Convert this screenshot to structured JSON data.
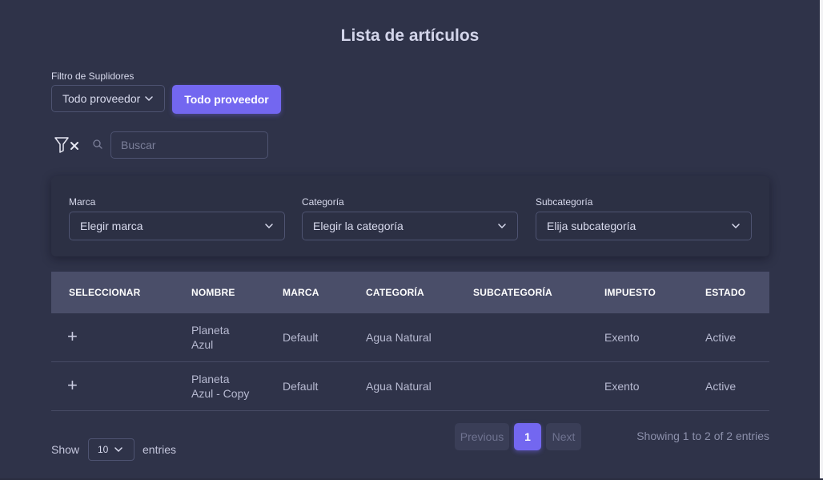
{
  "page": {
    "title": "Lista de artículos"
  },
  "supplier_filter": {
    "label": "Filtro de Suplidores",
    "select_value": "Todo proveedor",
    "button_label": "Todo proveedor"
  },
  "search": {
    "placeholder": "Buscar",
    "clear_icon": "filter-clear-icon",
    "icon": "search-icon"
  },
  "filters": {
    "brand": {
      "label": "Marca",
      "value": "Elegir marca"
    },
    "category": {
      "label": "Categoría",
      "value": "Elegir la categoría"
    },
    "subcategory": {
      "label": "Subcategoría",
      "value": "Elija subcategoría"
    }
  },
  "table": {
    "headers": {
      "select": "SELECCIONAR",
      "name": "NOMBRE",
      "brand": "MARCA",
      "category": "CATEGORÍA",
      "subcategory": "SUBCATEGORÍA",
      "tax": "IMPUESTO",
      "status": "ESTADO"
    },
    "rows": [
      {
        "select": "+",
        "name_line1": "Planeta",
        "name_line2": "Azul",
        "brand": "Default",
        "category": "Agua Natural",
        "subcategory": "",
        "tax": "Exento",
        "status": "Active"
      },
      {
        "select": "+",
        "name_line1": "Planeta",
        "name_line2": "Azul - Copy",
        "brand": "Default",
        "category": "Agua Natural",
        "subcategory": "",
        "tax": "Exento",
        "status": "Active"
      }
    ]
  },
  "footer": {
    "show_label": "Show",
    "page_length": "10",
    "entries_label": "entries",
    "pagination": {
      "previous": "Previous",
      "current": "1",
      "next": "Next"
    },
    "info": "Showing 1 to 2 of 2 entries"
  },
  "colors": {
    "background": "#2f3349",
    "accent": "#7367f0",
    "table_header": "#4a4e69"
  }
}
